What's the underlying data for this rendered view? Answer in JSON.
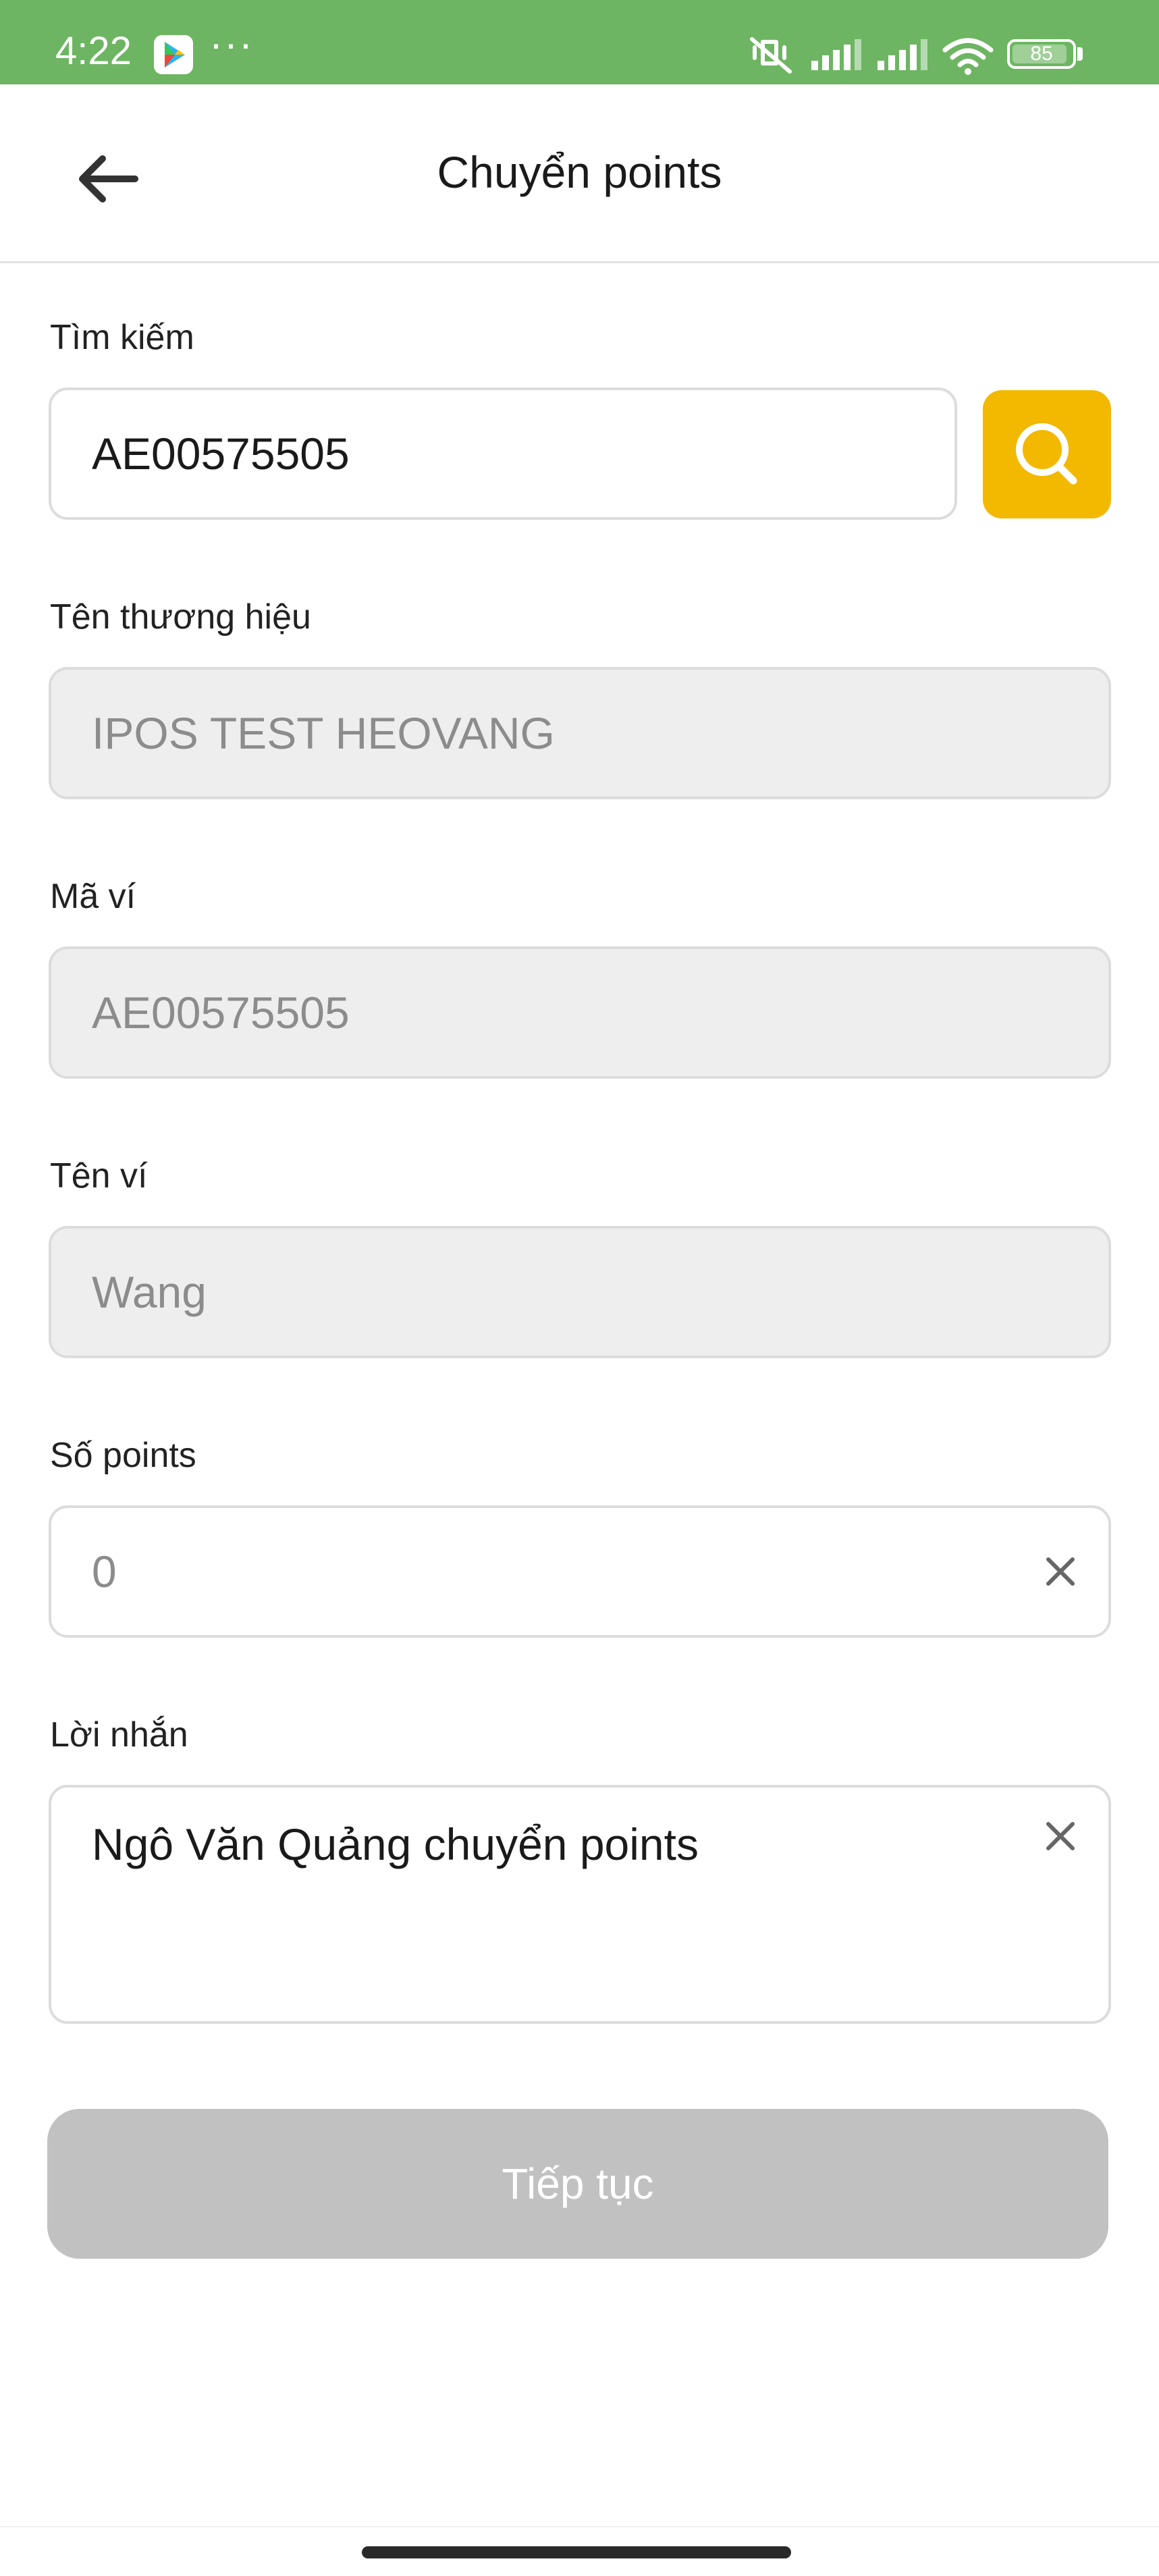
{
  "status_bar": {
    "time": "4:22",
    "dots": "···",
    "battery": "85",
    "icons": [
      "play-store-icon",
      "mute-icon",
      "signal-icon",
      "signal-icon",
      "wifi-icon",
      "battery-icon"
    ],
    "color": "#6db562"
  },
  "header": {
    "title": "Chuyển points",
    "back_icon": "arrow-left-icon"
  },
  "search": {
    "label": "Tìm kiếm",
    "value": "AE00575505",
    "button_icon": "search-icon",
    "button_color": "#f3b800"
  },
  "brand": {
    "label": "Tên thương hiệu",
    "value": "IPOS TEST HEOVANG"
  },
  "wallet_code": {
    "label": "Mã ví",
    "value": "AE00575505"
  },
  "wallet_name": {
    "label": "Tên ví",
    "value": "Wang"
  },
  "points": {
    "label": "Số points",
    "value": "0",
    "clear_icon": "close-icon"
  },
  "message": {
    "label": "Lời nhắn",
    "value": "Ngô Văn Quảng chuyển points",
    "clear_icon": "close-icon"
  },
  "continue_button": {
    "label": "Tiếp tục",
    "state": "disabled",
    "color": "#c1c1c1"
  }
}
